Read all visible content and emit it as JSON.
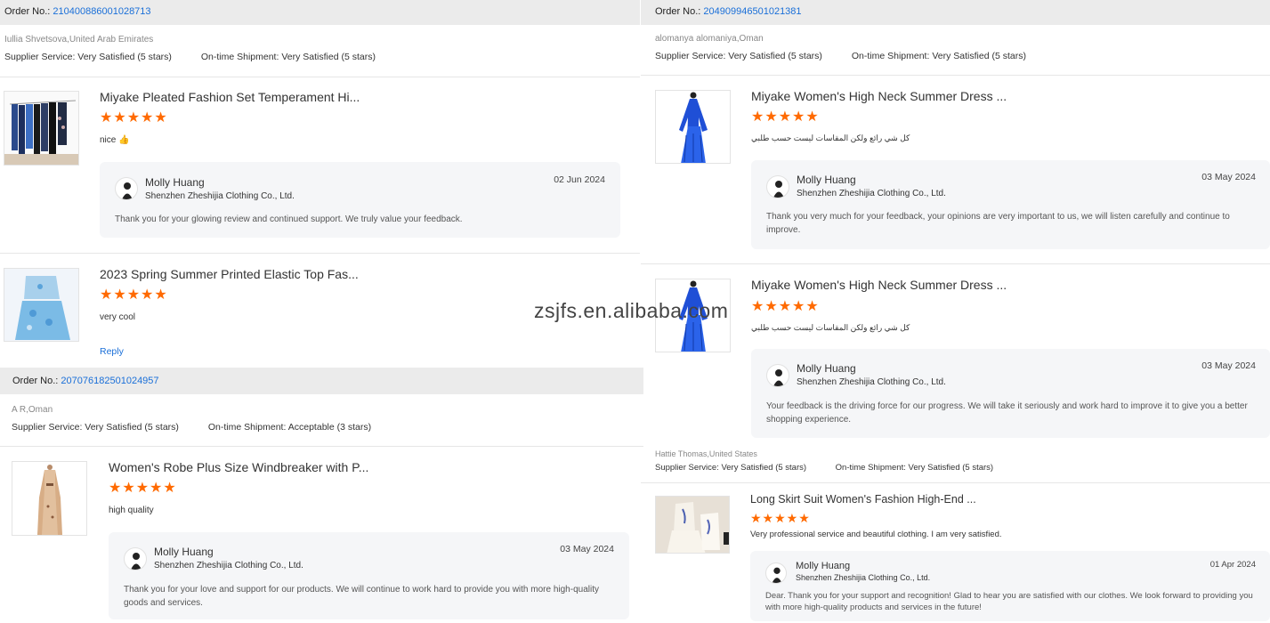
{
  "order_label": "Order No.:",
  "orders": [
    {
      "number": "210400886001028713"
    },
    {
      "number": "204909946501021381"
    },
    {
      "number": "207076182501024957"
    }
  ],
  "reviewers": [
    {
      "name": "Iullia Shvetsova,United Arab Emirates",
      "supplier_label": "Supplier Service:",
      "supplier_value": "Very Satisfied",
      "supplier_stars": "(5 stars)",
      "shipment_label": "On-time Shipment:",
      "shipment_value": "Very Satisfied",
      "shipment_stars": "(5 stars)"
    },
    {
      "name": "alomanya alomaniya,Oman",
      "supplier_label": "Supplier Service:",
      "supplier_value": "Very Satisfied",
      "supplier_stars": "(5 stars)",
      "shipment_label": "On-time Shipment:",
      "shipment_value": "Very Satisfied",
      "shipment_stars": "(5 stars)"
    },
    {
      "name": "A R,Oman",
      "supplier_label": "Supplier Service:",
      "supplier_value": "Very Satisfied",
      "supplier_stars": "(5 stars)",
      "shipment_label": "On-time Shipment:",
      "shipment_value": "Acceptable",
      "shipment_stars": "(3 stars)"
    },
    {
      "name": "Hattie Thomas,United States",
      "supplier_label": "Supplier Service:",
      "supplier_value": "Very Satisfied",
      "supplier_stars": "(5 stars)",
      "shipment_label": "On-time Shipment:",
      "shipment_value": "Very Satisfied",
      "shipment_stars": "(5 stars)"
    }
  ],
  "reviews": [
    {
      "title": "Miyake Pleated Fashion Set Temperament Hi...",
      "stars": "★★★★★",
      "rating": 5,
      "text": "nice 👍",
      "reply": {
        "name": "Molly Huang",
        "company": "Shenzhen Zheshijia Clothing Co., Ltd.",
        "date": "02 Jun 2024",
        "message": "Thank you for your glowing review and continued support. We truly value your feedback."
      }
    },
    {
      "title": "2023 Spring Summer Printed Elastic Top Fas...",
      "stars": "★★★★★",
      "rating": 5,
      "text": "very cool",
      "reply_link": "Reply"
    },
    {
      "title": "Miyake Women's High Neck Summer Dress ...",
      "stars": "★★★★★",
      "rating": 5,
      "text": "كل شي رائع ولكن المقاسات ليست حسب طلبي",
      "reply": {
        "name": "Molly Huang",
        "company": "Shenzhen Zheshijia Clothing Co., Ltd.",
        "date": "03 May 2024",
        "message": "Thank you very much for your feedback, your opinions are very important to us, we will listen carefully and continue to improve."
      }
    },
    {
      "title": "Miyake Women's High Neck Summer Dress ...",
      "stars": "★★★★★",
      "rating": 5,
      "text": "كل شي رائع ولكن المقاسات ليست حسب طلبي",
      "reply": {
        "name": "Molly Huang",
        "company": "Shenzhen Zheshijia Clothing Co., Ltd.",
        "date": "03 May 2024",
        "message": "Your feedback is the driving force for our progress. We will take it seriously and work hard to improve it to give you a better shopping experience."
      }
    },
    {
      "title": "Women's Robe Plus Size Windbreaker with P...",
      "stars": "★★★★★",
      "rating": 5,
      "text": "high quality",
      "reply": {
        "name": "Molly Huang",
        "company": "Shenzhen Zheshijia Clothing Co., Ltd.",
        "date": "03 May 2024",
        "message": "Thank you for your love and support for our products. We will continue to work hard to provide you with more high-quality goods and services."
      }
    },
    {
      "title": "Long Skirt Suit Women's Fashion High-End ...",
      "stars": "★★★★★",
      "rating": 5,
      "text": "Very professional service and beautiful clothing. I am very satisfied.",
      "reply": {
        "name": "Molly Huang",
        "company": "Shenzhen Zheshijia Clothing Co., Ltd.",
        "date": "01 Apr 2024",
        "message": "Dear. Thank you for your support and recognition! Glad to hear you are satisfied with our clothes. We look forward to providing you with more high-quality products and services in the future!"
      }
    }
  ],
  "watermark": "zsjfs.en.alibaba.com",
  "colors": {
    "accent": "#1a6fd8",
    "star": "#ff6a00",
    "order_bar": "#ebebeb",
    "reply_bg": "#f5f6f8"
  }
}
